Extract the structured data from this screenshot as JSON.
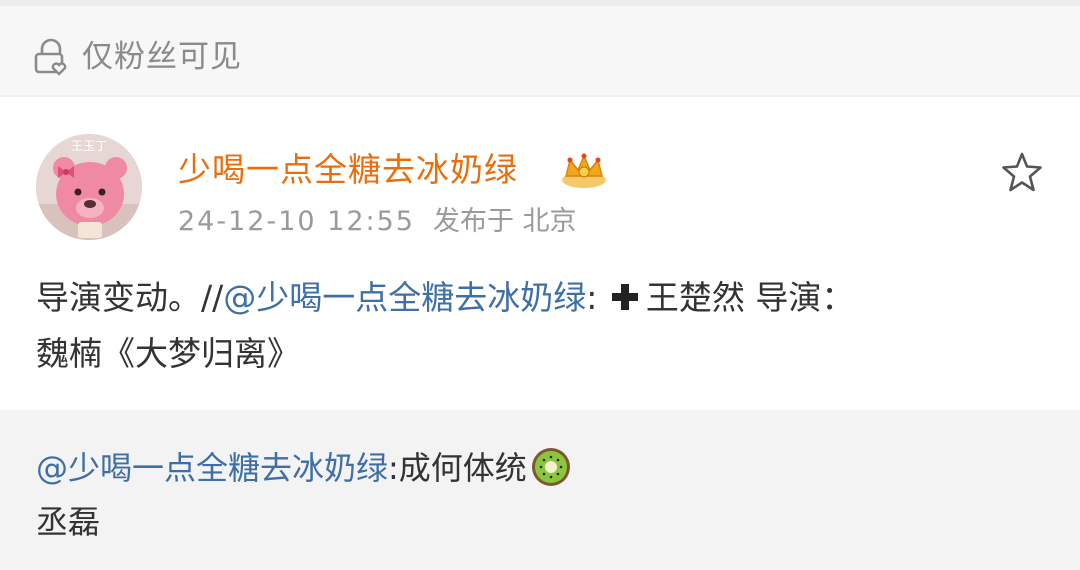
{
  "visibility": {
    "icon": "lock-heart-icon",
    "label": "仅粉丝可见"
  },
  "post": {
    "avatar": {
      "badge_text": "王玉丁"
    },
    "author": "少喝一点全糖去冰奶绿",
    "author_badge": "crown-icon",
    "timestamp": "24-12-10 12:55",
    "location": "发布于 北京",
    "favorite_icon": "star-outline-icon",
    "content": {
      "lead": "导演变动。//",
      "mention": "@少喝一点全糖去冰奶绿",
      "after_mention": ":",
      "plus_icon": "plus-icon",
      "rest_line1": "王楚然 导演：",
      "line2": "魏楠《大梦归离》"
    }
  },
  "repost": {
    "mention": "@少喝一点全糖去冰奶绿",
    "text_after": ":成何体统",
    "emoji": "kiwi-icon",
    "line2": "丞磊"
  },
  "colors": {
    "author": "#e86e0e",
    "mention": "#3e6fa6",
    "meta": "#9a9a9a",
    "repost_bg": "#f3f3f3"
  }
}
